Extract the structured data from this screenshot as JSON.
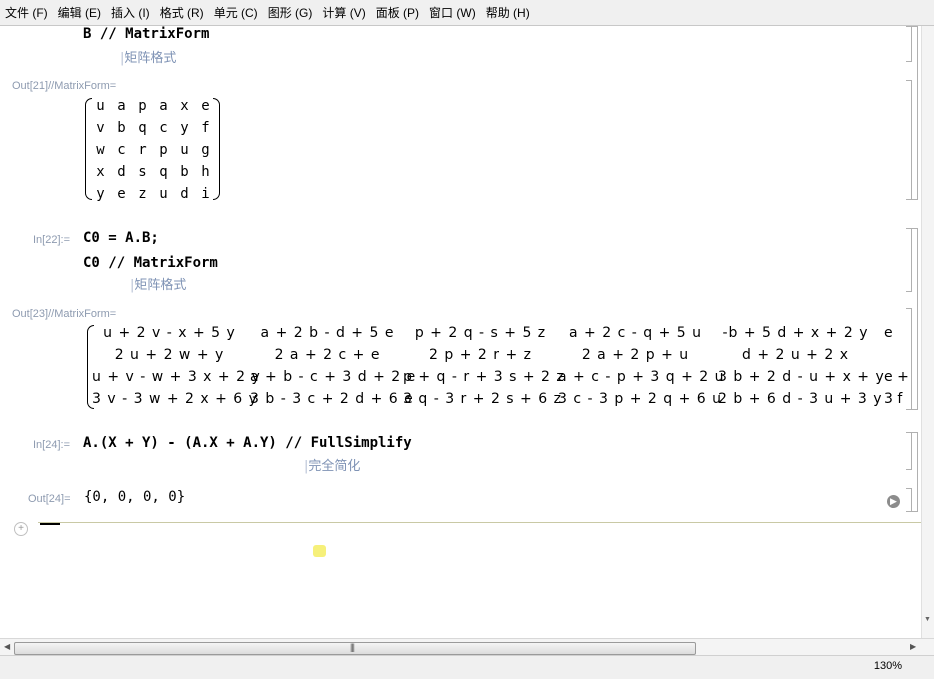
{
  "menu": [
    "文件 (F)",
    "编辑 (E)",
    "插入 (I)",
    "格式 (R)",
    "单元 (C)",
    "图形 (G)",
    "计算 (V)",
    "面板 (P)",
    "窗口 (W)",
    "帮助 (H)"
  ],
  "cells": {
    "in_b": {
      "code": "B // MatrixForm",
      "hint": "矩阵格式"
    },
    "out21": {
      "label": "Out[21]//MatrixForm=",
      "rows": [
        [
          "u",
          "a",
          "p",
          "a",
          "x",
          "e"
        ],
        [
          "v",
          "b",
          "q",
          "c",
          "y",
          "f"
        ],
        [
          "w",
          "c",
          "r",
          "p",
          "u",
          "g"
        ],
        [
          "x",
          "d",
          "s",
          "q",
          "b",
          "h"
        ],
        [
          "y",
          "e",
          "z",
          "u",
          "d",
          "i"
        ]
      ]
    },
    "in22": {
      "label": "In[22]:=",
      "line1": "C0 = A.B;",
      "line2": "C0 // MatrixForm",
      "hint": "矩阵格式"
    },
    "out23": {
      "label": "Out[23]//MatrixForm=",
      "rows": [
        [
          "u + 2 v - x + 5 y",
          "a + 2 b - d + 5 e",
          "p + 2 q - s + 5 z",
          "a + 2 c - q + 5 u",
          "-b + 5 d + x + 2 y",
          "e"
        ],
        [
          "2 u + 2 w + y",
          "2 a + 2 c + e",
          "2 p + 2 r + z",
          "2 a + 2 p + u",
          "d + 2 u + 2 x",
          ""
        ],
        [
          "u + v - w + 3 x + 2 y",
          "a + b - c + 3 d + 2 e",
          "p + q - r + 3 s + 2 z",
          "a + c - p + 3 q + 2 u",
          "3 b + 2 d - u + x + y",
          "e +"
        ],
        [
          "3 v - 3 w + 2 x + 6 y",
          "3 b - 3 c + 2 d + 6 e",
          "3 q - 3 r + 2 s + 6 z",
          "3 c - 3 p + 2 q + 6 u",
          "2 b + 6 d - 3 u + 3 y",
          "3 f"
        ]
      ]
    },
    "in24": {
      "label": "In[24]:=",
      "code": "A.(X + Y) - (A.X + A.Y) // FullSimplify",
      "hint": "完全简化"
    },
    "out24": {
      "label": "Out[24]=",
      "value": "{0, 0, 0, 0}"
    }
  },
  "status": {
    "zoom": "130%"
  },
  "colors": {
    "label": "#8e9bb0",
    "hint": "#7f93b5",
    "separator": "#c9c9a5"
  }
}
